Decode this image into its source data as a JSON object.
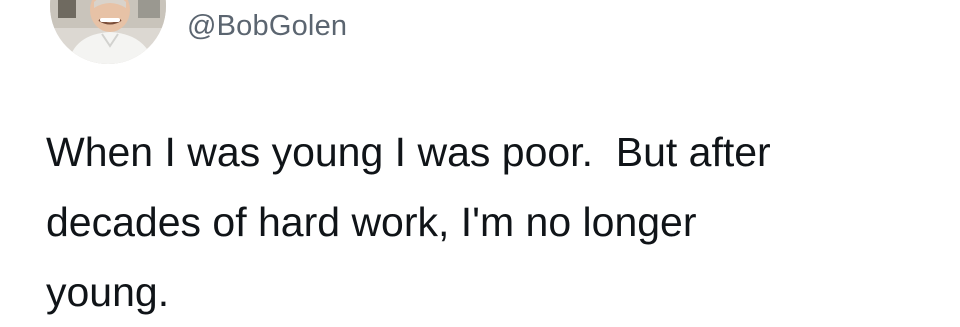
{
  "tweet": {
    "handle": "@BobGolen",
    "text_lines": [
      "When I was young I was poor.  But after",
      "decades of hard work, I'm no longer",
      "young."
    ]
  },
  "avatar": {
    "icon": "profile-photo"
  }
}
